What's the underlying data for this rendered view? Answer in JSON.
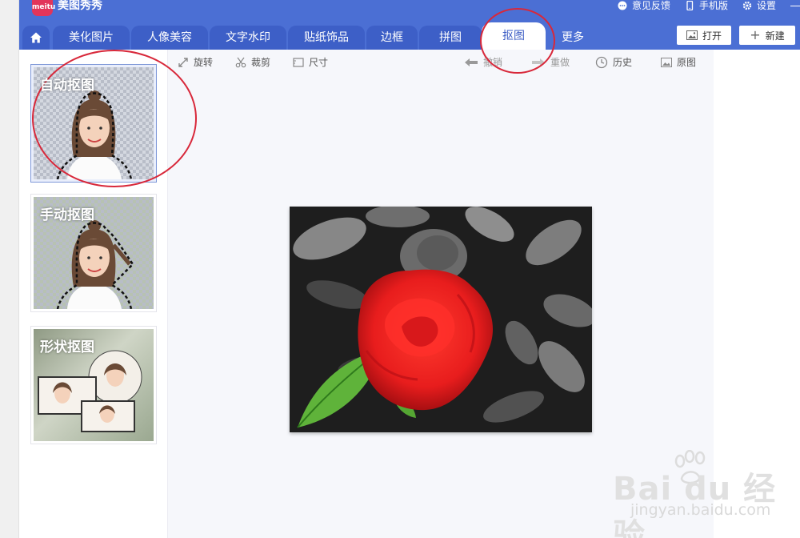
{
  "app": {
    "title": "美图秀秀",
    "logo_text": "meitu",
    "top_actions": [
      {
        "label": "意见反馈",
        "icon": "feedback-icon"
      },
      {
        "label": "手机版",
        "icon": "phone-icon"
      },
      {
        "label": "设置",
        "icon": "gear-icon"
      }
    ]
  },
  "tabs": {
    "home_icon": "home-icon",
    "items": [
      "美化图片",
      "人像美容",
      "文字水印",
      "贴纸饰品",
      "边框",
      "拼图",
      "抠图",
      "更多"
    ],
    "active": "抠图",
    "open_label": "打开",
    "new_label": "新建"
  },
  "left_panel": {
    "modes": [
      {
        "label": "自动抠图",
        "selected": true
      },
      {
        "label": "手动抠图",
        "selected": false
      },
      {
        "label": "形状抠图",
        "selected": false
      }
    ]
  },
  "toolbar": {
    "rotate": "旋转",
    "crop": "裁剪",
    "size": "尺寸",
    "undo": "撤销",
    "redo": "重做",
    "history": "历史",
    "original": "原图"
  },
  "watermark": {
    "main": "Bai du 经验",
    "sub": "jingyan.baidu.com"
  },
  "colors": {
    "brand_blue": "#4b6fd4",
    "highlight_red": "#d8283a",
    "rose_red": "#e81d1d",
    "leaf_green": "#5fb33a"
  }
}
